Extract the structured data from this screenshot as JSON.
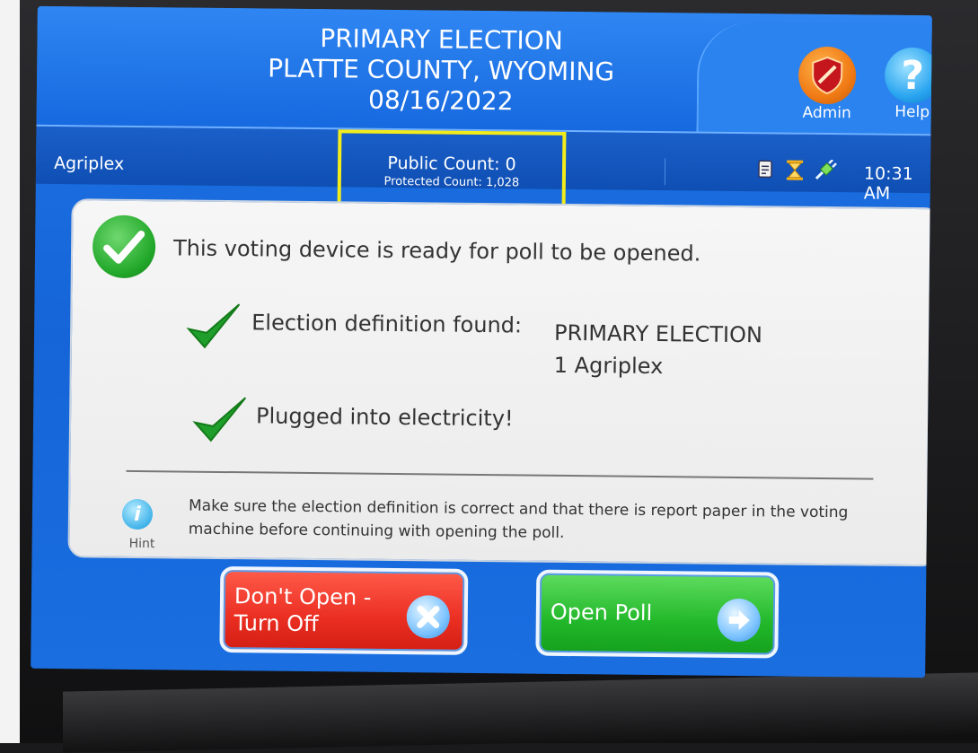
{
  "header": {
    "title_line1": "PRIMARY ELECTION",
    "title_line2": "PLATTE COUNTY, WYOMING",
    "title_line3": "08/16/2022",
    "admin_label": "Admin",
    "help_label": "Help"
  },
  "status_bar": {
    "location": "Agriplex",
    "public_count": "Public Count: 0",
    "protected_count": "Protected Count: 1,028",
    "time": "10:31 AM",
    "icons": [
      "report-printer-icon",
      "hourglass-icon",
      "power-plug-icon"
    ]
  },
  "panel": {
    "ready_message": "This voting device is ready for poll to be opened.",
    "definition_label": "Election definition found:",
    "definition_value_line1": "PRIMARY ELECTION",
    "definition_value_line2": "1 Agriplex",
    "power_message": "Plugged into electricity!",
    "hint_label": "Hint",
    "hint_text": "Make sure the election definition is correct and that there is report paper in the voting machine before continuing with opening the poll."
  },
  "buttons": {
    "dont_open_line1": "Don't Open -",
    "dont_open_line2": "Turn Off",
    "open_poll": "Open Poll"
  },
  "colors": {
    "screen_blue": "#1a6ee0",
    "highlight_box": "#f2ec1b",
    "turn_off_red": "#ea2e22",
    "open_green": "#22b82a"
  }
}
